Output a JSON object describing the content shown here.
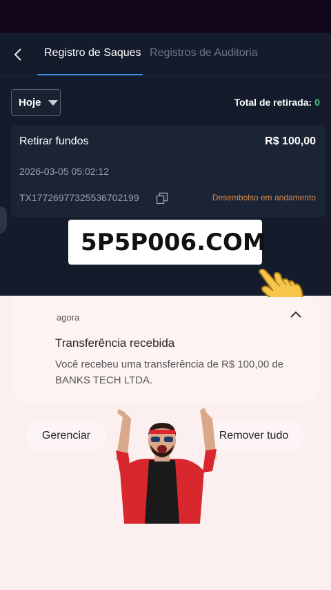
{
  "header": {
    "tabs": [
      {
        "label": "Registro de Saques",
        "active": true
      },
      {
        "label": "Registros de Auditoria",
        "active": false
      }
    ]
  },
  "filter": {
    "selected": "Hoje"
  },
  "total": {
    "label": "Total de retirada:",
    "value": "0"
  },
  "withdrawal": {
    "title": "Retirar fundos",
    "amount": "R$ 100,00",
    "datetime": "2026-03-05 05:02:12",
    "tx_id": "TX17726977325536702199",
    "status": "Desembolso em andamento"
  },
  "watermark": {
    "text": "5P5P006.COM"
  },
  "notification": {
    "time": "agora",
    "title": "Transferência recebida",
    "body": "Você recebeu uma transferência de R$ 100,00 de BANKS TECH LTDA."
  },
  "actions": {
    "manage": "Gerenciar",
    "clear_all": "Remover tudo"
  },
  "colors": {
    "app_bg": "#141c2c",
    "accent": "#3b8fe8",
    "total_value": "#4cc58a",
    "status": "#d98a4a",
    "notification_bg": "#fbeff0"
  },
  "icons": [
    "back-arrow-icon",
    "caret-down-icon",
    "copy-icon",
    "link-icon",
    "pointing-hand-icon",
    "chevron-up-icon"
  ]
}
